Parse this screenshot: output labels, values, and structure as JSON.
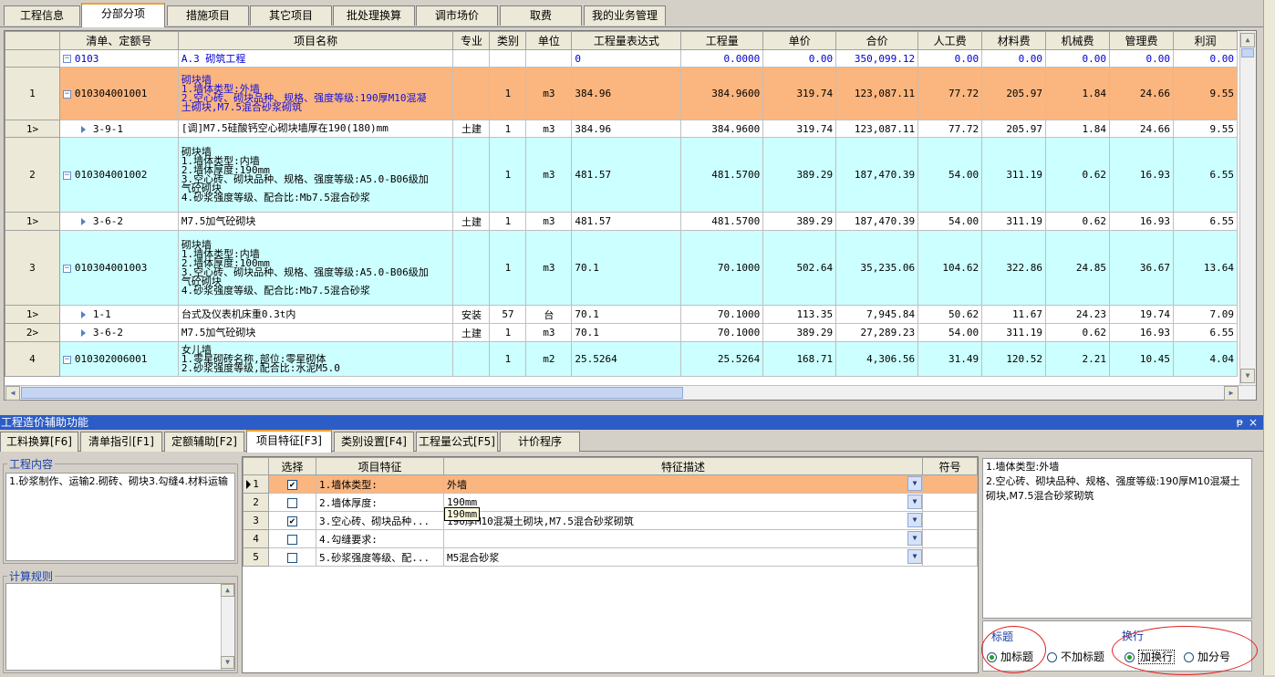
{
  "top_tabs": [
    {
      "label": "工程信息"
    },
    {
      "label": "分部分项"
    },
    {
      "label": "措施项目"
    },
    {
      "label": "其它项目"
    },
    {
      "label": "批处理换算"
    },
    {
      "label": "调市场价"
    },
    {
      "label": "取费"
    },
    {
      "label": "我的业务管理"
    }
  ],
  "active_top_tab": "分部分项",
  "main_grid": {
    "columns": [
      "清单、定额号",
      "项目名称",
      "专业",
      "类别",
      "单位",
      "工程量表达式",
      "工程量",
      "单价",
      "合价",
      "人工费",
      "材料费",
      "机械费",
      "管理费",
      "利润"
    ],
    "rows": [
      {
        "num": "",
        "code": "0103",
        "name": "A.3 砌筑工程",
        "major": "",
        "cat": "",
        "unit": "",
        "expr": "0",
        "qty": "0.0000",
        "price": "0.00",
        "total": "350,099.12",
        "labor": "0.00",
        "material": "0.00",
        "machine": "0.00",
        "mgmt": "0.00",
        "profit": "0.00"
      },
      {
        "num": "1",
        "code": "010304001001",
        "name": "砌块墙\n1.墙体类型:外墙\n2.空心砖、砌块品种、规格、强度等级:190厚M10混凝\n土砌块,M7.5混合砂浆砌筑",
        "major": "",
        "cat": "1",
        "unit": "m3",
        "expr": "384.96",
        "qty": "384.9600",
        "price": "319.74",
        "total": "123,087.11",
        "labor": "77.72",
        "material": "205.97",
        "machine": "1.84",
        "mgmt": "24.66",
        "profit": "9.55"
      },
      {
        "num": "1>",
        "code": "3-9-1",
        "name": "[调]M7.5硅酸钙空心砌块墙厚在190(180)mm",
        "major": "土建",
        "cat": "1",
        "unit": "m3",
        "expr": "384.96",
        "qty": "384.9600",
        "price": "319.74",
        "total": "123,087.11",
        "labor": "77.72",
        "material": "205.97",
        "machine": "1.84",
        "mgmt": "24.66",
        "profit": "9.55"
      },
      {
        "num": "2",
        "code": "010304001002",
        "name": "砌块墙\n1.墙体类型:内墙\n2.墙体厚度:190mm\n3.空心砖、砌块品种、规格、强度等级:A5.0-B06级加\n气砼砌块\n4.砂浆强度等级、配合比:Mb7.5混合砂浆",
        "major": "",
        "cat": "1",
        "unit": "m3",
        "expr": "481.57",
        "qty": "481.5700",
        "price": "389.29",
        "total": "187,470.39",
        "labor": "54.00",
        "material": "311.19",
        "machine": "0.62",
        "mgmt": "16.93",
        "profit": "6.55"
      },
      {
        "num": "1>",
        "code": "3-6-2",
        "name": "M7.5加气砼砌块",
        "major": "土建",
        "cat": "1",
        "unit": "m3",
        "expr": "481.57",
        "qty": "481.5700",
        "price": "389.29",
        "total": "187,470.39",
        "labor": "54.00",
        "material": "311.19",
        "machine": "0.62",
        "mgmt": "16.93",
        "profit": "6.55"
      },
      {
        "num": "3",
        "code": "010304001003",
        "name": "砌块墙\n1.墙体类型:内墙\n2.墙体厚度:100mm\n3.空心砖、砌块品种、规格、强度等级:A5.0-B06级加\n气砼砌块\n4.砂浆强度等级、配合比:Mb7.5混合砂浆",
        "major": "",
        "cat": "1",
        "unit": "m3",
        "expr": "70.1",
        "qty": "70.1000",
        "price": "502.64",
        "total": "35,235.06",
        "labor": "104.62",
        "material": "322.86",
        "machine": "24.85",
        "mgmt": "36.67",
        "profit": "13.64"
      },
      {
        "num": "1>",
        "code": "1-1",
        "name": "台式及仪表机床重0.3t内",
        "major": "安装",
        "cat": "57",
        "unit": "台",
        "expr": "70.1",
        "qty": "70.1000",
        "price": "113.35",
        "total": "7,945.84",
        "labor": "50.62",
        "material": "11.67",
        "machine": "24.23",
        "mgmt": "19.74",
        "profit": "7.09"
      },
      {
        "num": "2>",
        "code": "3-6-2",
        "name": "M7.5加气砼砌块",
        "major": "土建",
        "cat": "1",
        "unit": "m3",
        "expr": "70.1",
        "qty": "70.1000",
        "price": "389.29",
        "total": "27,289.23",
        "labor": "54.00",
        "material": "311.19",
        "machine": "0.62",
        "mgmt": "16.93",
        "profit": "6.55"
      },
      {
        "num": "4",
        "code": "010302006001",
        "name": "女儿墙\n1.零星砌砖名称,部位:零星砌体\n2.砂浆强度等级,配合比:水泥M5.0",
        "major": "",
        "cat": "1",
        "unit": "m2",
        "expr": "25.5264",
        "qty": "25.5264",
        "price": "168.71",
        "total": "4,306.56",
        "labor": "31.49",
        "material": "120.52",
        "machine": "2.21",
        "mgmt": "10.45",
        "profit": "4.04"
      }
    ]
  },
  "assist_panel": {
    "title": "工程造价辅助功能",
    "pin": "ᵽ",
    "close": "×",
    "tabs": [
      {
        "label": "工料换算[F6]"
      },
      {
        "label": "清单指引[F1]"
      },
      {
        "label": "定额辅助[F2]"
      },
      {
        "label": "项目特征[F3]"
      },
      {
        "label": "类别设置[F4]"
      },
      {
        "label": "工程量公式[F5]"
      },
      {
        "label": "计价程序"
      }
    ],
    "work_content_legend": "工程内容",
    "work_content": "1.砂浆制作、运输2.砌砖、砌块3.勾缝4.材料运输",
    "calc_rule_legend": "计算规则",
    "calc_rule": ""
  },
  "feature_grid": {
    "columns": [
      "选择",
      "项目特征",
      "特征描述",
      "符号"
    ],
    "rows": [
      {
        "num": "1",
        "checked": true,
        "feature": "1.墙体类型:",
        "desc": "外墙",
        "symbol": ""
      },
      {
        "num": "2",
        "checked": false,
        "feature": "2.墙体厚度:",
        "desc": "190mm",
        "symbol": ""
      },
      {
        "num": "3",
        "checked": true,
        "feature": "3.空心砖、砌块品种...",
        "desc": "190厚M10混凝土砌块,M7.5混合砂浆砌筑",
        "symbol": ""
      },
      {
        "num": "4",
        "checked": false,
        "feature": "4.勾缝要求:",
        "desc": "",
        "symbol": ""
      },
      {
        "num": "5",
        "checked": false,
        "feature": "5.砂浆强度等级、配...",
        "desc": "M5混合砂浆",
        "symbol": ""
      }
    ],
    "tooltip": "190mm"
  },
  "preview": {
    "text": "1.墙体类型:外墙\n2.空心砖、砌块品种、规格、强度等级:190厚M10混凝土砌块,M7.5混合砂浆砌筑",
    "title_group_label": "标题",
    "add_title": "加标题",
    "no_title": "不加标题",
    "newline_group_label": "换行",
    "add_newline": "加换行",
    "add_semicolon": "加分号"
  },
  "colors": {
    "accent_orange": "#fbb57e",
    "row_cyan": "#ccffff",
    "title_bar": "#2c5cc6",
    "highlight_ring": "#e02020"
  }
}
